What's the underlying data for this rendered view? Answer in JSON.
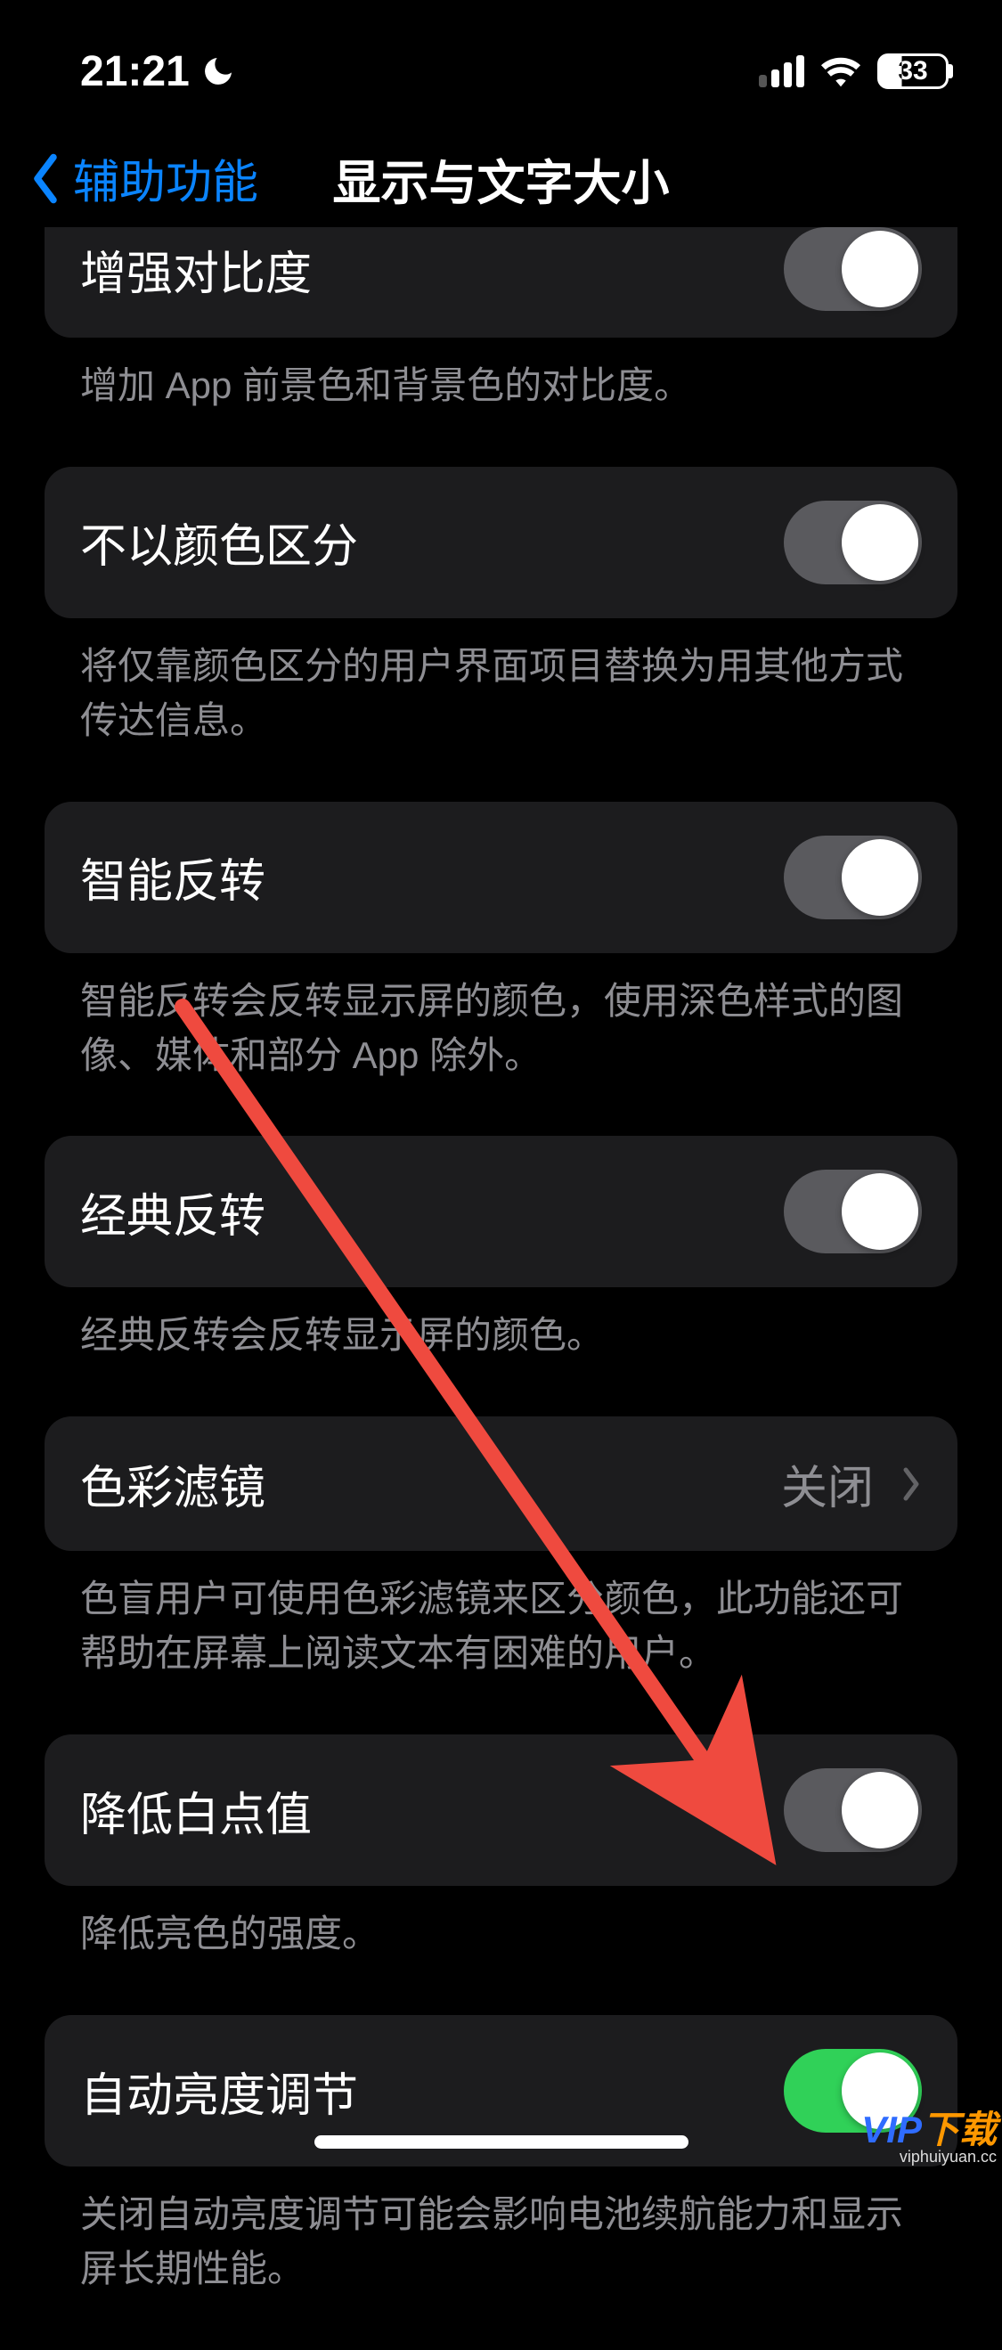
{
  "status": {
    "time": "21:21",
    "battery_percent": "33"
  },
  "nav": {
    "back_label": "辅助功能",
    "title": "显示与文字大小"
  },
  "rows": {
    "increase_contrast": {
      "label": "增强对比度",
      "footer": "增加 App 前景色和背景色的对比度。"
    },
    "differentiate_without_color": {
      "label": "不以颜色区分",
      "footer": "将仅靠颜色区分的用户界面项目替换为用其他方式传达信息。"
    },
    "smart_invert": {
      "label": "智能反转",
      "footer": "智能反转会反转显示屏的颜色，使用深色样式的图像、媒体和部分 App 除外。"
    },
    "classic_invert": {
      "label": "经典反转",
      "footer": "经典反转会反转显示屏的颜色。"
    },
    "color_filters": {
      "label": "色彩滤镜",
      "value": "关闭",
      "footer": "色盲用户可使用色彩滤镜来区分颜色，此功能还可帮助在屏幕上阅读文本有困难的用户。"
    },
    "reduce_white_point": {
      "label": "降低白点值",
      "footer": "降低亮色的强度。"
    },
    "auto_brightness": {
      "label": "自动亮度调节",
      "footer": "关闭自动亮度调节可能会影响电池续航能力和显示屏长期性能。"
    }
  },
  "watermark": {
    "brand": "VIP",
    "brand_suffix": "下载",
    "url": "viphuiyuan.cc"
  }
}
